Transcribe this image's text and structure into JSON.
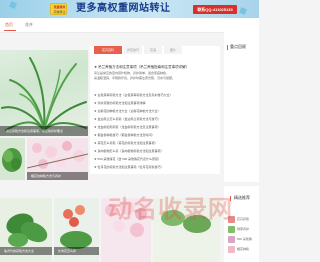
{
  "banner": {
    "tag_line1": "流量精准",
    "tag_line2": "高效转让",
    "headline": "更多高权重网站转让",
    "contact": "联系QQ:411025133",
    "colors": {
      "headline": "#1a3a8a",
      "contact_bg": "#d9302a",
      "tag_bg": "#f7d43c"
    }
  },
  "nav": {
    "tabs": [
      {
        "label": "首页",
        "active": true
      },
      {
        "label": "花卉",
        "active": false
      }
    ],
    "accent": "#e05a47"
  },
  "hero": {
    "caption": "吊兰养殖方法和注意事项，吊兰的养护要点"
  },
  "thumbs": [
    {
      "caption": "绿萝怎么养"
    },
    {
      "caption": "樱花的种植方法与养护"
    }
  ],
  "article_panel": {
    "tabs": [
      {
        "label": "花卉百科",
        "active": true
      },
      {
        "label": "养花技巧",
        "active": false
      },
      {
        "label": "花语",
        "active": false
      },
      {
        "label": "图片",
        "active": false
      }
    ],
    "title": "★ 吊兰养殖方法和注意事项（吊兰养殖指南和注意事项详解）",
    "lines": [
      "吊兰是常见的室内观叶植物，养护简单，适合家庭种植，",
      "喜温暖湿润、半阴的环境，养护时需注意光照、浇水与施肥。"
    ],
    "list": [
      "★ 白色茶梅养殖方法（白色茶梅养殖方法及养护技巧大全）",
      "★ 滴水观音的养殖方法和注意事项详解",
      "★ 迎春花的种植方法大全（迎春花种植方法大全）",
      "★ 金边吊兰怎么养殖（金边吊兰养殖方法与技巧）",
      "★ 龙血树如何养殖（龙血树养殖方法及注意事项）",
      "★ 郁金香种植技巧（郁金香种植方法及时间）",
      "★ 菊花怎么养殖（菊花的养殖方法和注意事项）",
      "★ 多肉植物怎么养（多肉植物养殖方法和注意事项）",
      "★ 500 朵玫瑰花（送 500 朵玫瑰花代表什么意思）",
      "★ 牡丹花的养殖方法和注意事项（牡丹花养殖技巧）"
    ]
  },
  "sidebar": {
    "title": "重点回顾"
  },
  "picks": {
    "title": "精选推荐",
    "items": [
      {
        "label": "花卉养殖"
      },
      {
        "label": "绿萝养护"
      },
      {
        "label": "500 朵玫瑰"
      },
      {
        "label": "樱花种植"
      }
    ]
  },
  "bottom": {
    "captions": [
      "龟背竹的养殖方法大全",
      "长寿花怎么养"
    ]
  },
  "watermark": "动名收录网"
}
